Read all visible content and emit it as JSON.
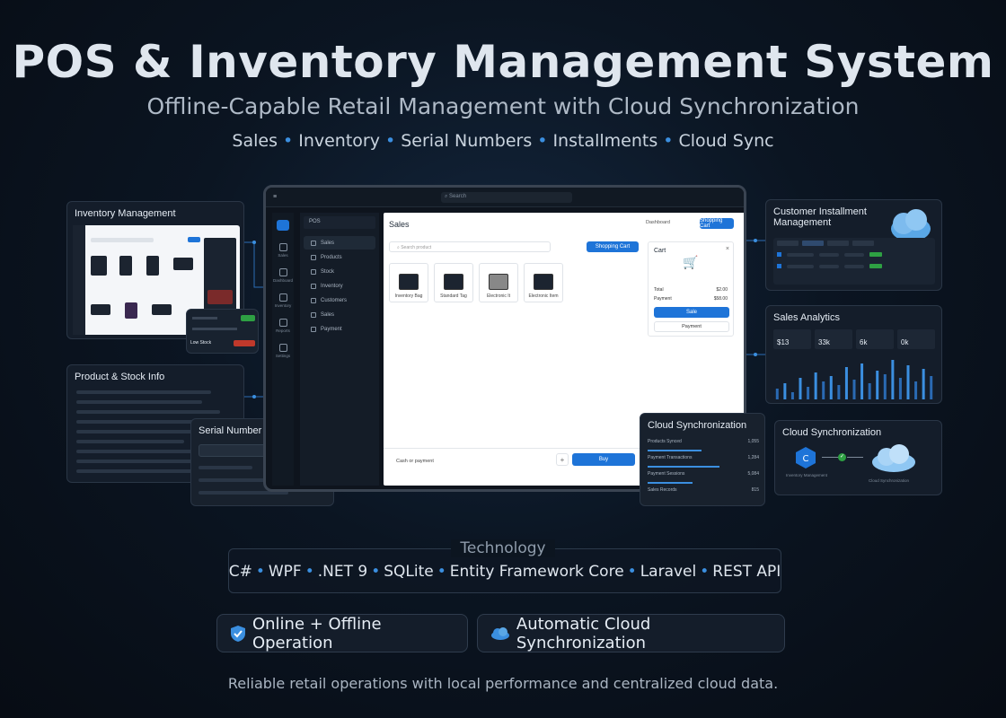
{
  "hero": {
    "title": "POS & Inventory Management System",
    "subtitle": "Offline-Capable Retail Management with Cloud Synchronization",
    "features": [
      "Sales",
      "Inventory",
      "Serial Numbers",
      "Installments",
      "Cloud Sync"
    ]
  },
  "inventory_panel": {
    "title": "Inventory Management",
    "alert_low": "Low Stock"
  },
  "product_panel": {
    "title": "Product & Stock Info"
  },
  "serial_panel": {
    "title": "Serial Number Tracking"
  },
  "installment_panel": {
    "title": "Customer Installment Management"
  },
  "analytics_panel": {
    "title": "Sales Analytics",
    "kpis": [
      "$13",
      "33k",
      "6k",
      "0k"
    ],
    "bars": [
      6,
      9,
      4,
      12,
      7,
      15,
      10,
      13,
      8,
      18,
      11,
      20,
      9,
      16,
      14,
      22,
      12,
      19,
      10,
      17,
      13
    ]
  },
  "sync_panel_a": {
    "title": "Cloud Synchronization",
    "rows": [
      {
        "label": "Products Synced",
        "value": "1,055"
      },
      {
        "label": "Payment Transactions",
        "value": "1,284"
      },
      {
        "label": "Payment Sessions",
        "value": "5,084"
      },
      {
        "label": "Sales Records",
        "value": "815"
      }
    ]
  },
  "sync_panel_b": {
    "title": "Cloud Synchronization",
    "left_label": "Inventory Management",
    "right_label": "Cloud Synchronization"
  },
  "main_window": {
    "search_placeholder": "Search",
    "side_header": "POS",
    "nav": [
      "Sales",
      "Products",
      "Stock",
      "Inventory",
      "Customers",
      "Sales",
      "Payment"
    ],
    "rail": [
      "Dashboard",
      "Sales",
      "Inventory",
      "Reports",
      "Settings"
    ],
    "content_title": "Sales",
    "content_search": "Search product",
    "dashboard_btn": "Dashboard",
    "cart_btn": "Shopping Cart",
    "products": [
      "Inventory Bag",
      "Standard Tag",
      "Electronic It",
      "Electronic Item"
    ],
    "cart": {
      "title": "Cart",
      "total_label": "Total",
      "total_value": "$2.00",
      "payment_label": "Payment",
      "payment_value": "$58.00",
      "sale_btn": "Sale",
      "payment_btn": "Payment"
    },
    "footer_text": "Cash or payment",
    "buy_btn": "Buy"
  },
  "technology": {
    "label": "Technology",
    "items": [
      "C#",
      "WPF",
      ".NET 9",
      "SQLite",
      "Entity Framework Core",
      "Laravel",
      "REST API"
    ]
  },
  "pills": {
    "offline": "Online + Offline Operation",
    "sync": "Automatic Cloud Synchronization"
  },
  "footer": "Reliable retail operations with local performance and centralized cloud data.",
  "colors": {
    "accent": "#1e74d8",
    "bg": "#0b1522",
    "success": "#2ea043",
    "danger": "#c0392b"
  }
}
